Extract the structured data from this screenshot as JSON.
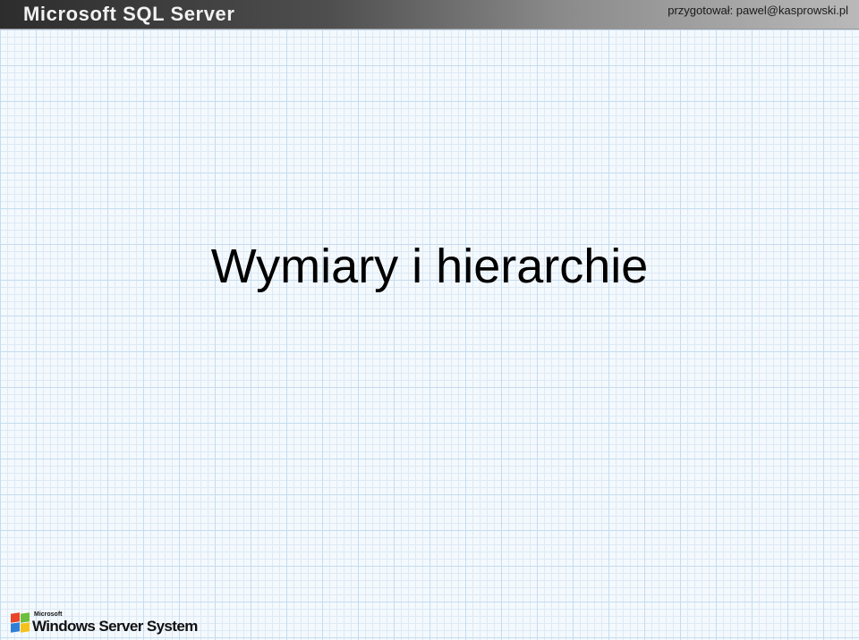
{
  "header": {
    "logo_text": "Microsoft SQL Server",
    "author": "przygotował: pawel@kasprowski.pl"
  },
  "slide": {
    "title": "Wymiary i hierarchie"
  },
  "footer": {
    "brand_small": "Microsoft",
    "brand_name": "Windows Server System",
    "logo_icon": "windows-flag-icon"
  },
  "colors": {
    "background": "#f4f9fd",
    "grid_major": "#c4dcf0",
    "grid_minor": "#dde9f5",
    "header_dark": "#2d2d2d",
    "header_light": "#b9b9b9"
  }
}
